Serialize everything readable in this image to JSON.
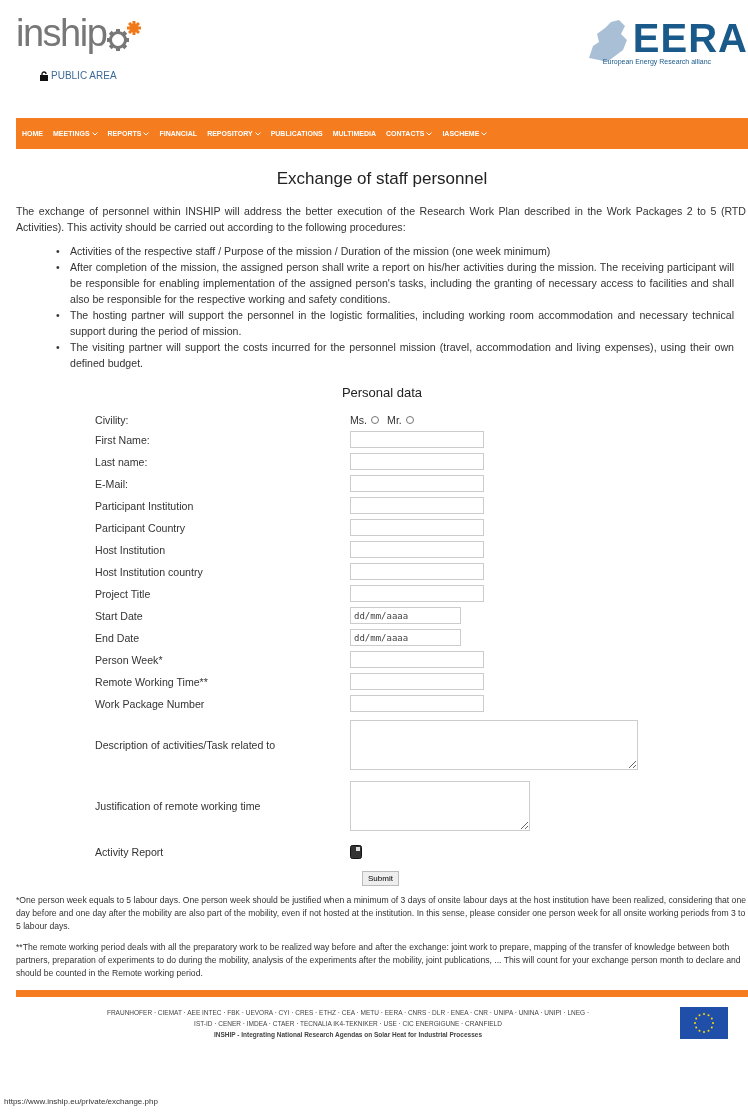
{
  "header": {
    "logo_text": "inship",
    "public_area": "PUBLIC AREA",
    "partner_logo": {
      "text": "EERA",
      "tagline": "European Energy Research allianc"
    }
  },
  "nav": [
    {
      "label": "HOME",
      "dropdown": false
    },
    {
      "label": "MEETINGS",
      "dropdown": true
    },
    {
      "label": "REPORTS",
      "dropdown": true
    },
    {
      "label": "FINANCIAL",
      "dropdown": false
    },
    {
      "label": "REPOSITORY",
      "dropdown": true
    },
    {
      "label": "PUBLICATIONS",
      "dropdown": false
    },
    {
      "label": "MULTIMEDIA",
      "dropdown": false
    },
    {
      "label": "CONTACTS",
      "dropdown": true
    },
    {
      "label": "IASCHEME",
      "dropdown": true
    }
  ],
  "title": "Exchange of staff personnel",
  "intro": "The exchange of personnel within INSHIP will address the better execution of the Research Work Plan described in the Work Packages 2 to 5 (RTD Activities). This activity should be carried out according to the following procedures:",
  "procedures": [
    {
      "marker": "•",
      "text": "Activities of the respective staff / Purpose of the mission / Duration of the mission (one week minimum)"
    },
    {
      "marker": "•",
      "text": "After completion of the mission, the assigned person shall write a report on his/her activities during the mission. The receiving participant will be responsible for enabling implementation of the assigned person's tasks, including the granting of necessary access to facilities and shall also be responsible for the respective working and safety conditions."
    },
    {
      "marker": "•",
      "text": "The hosting partner will support the personnel in the logistic formalities, including working room accommodation and necessary technical support during the period of mission."
    },
    {
      "marker": "•",
      "text": "The visiting partner will support the costs incurred for the personnel mission (travel, accommodation and living expenses), using their own defined budget."
    }
  ],
  "form": {
    "title": "Personal data",
    "fields": [
      {
        "kind": "radio",
        "label": "Civility:",
        "options": [
          {
            "label": "Ms.",
            "selected": false
          },
          {
            "label": "Mr.",
            "selected": false
          }
        ]
      },
      {
        "kind": "text",
        "label": "First Name:"
      },
      {
        "kind": "text",
        "label": "Last name:"
      },
      {
        "kind": "text",
        "label": "E-Mail:"
      },
      {
        "kind": "text",
        "label": "Participant Institution"
      },
      {
        "kind": "text",
        "label": "Participant Country"
      },
      {
        "kind": "text",
        "label": "Host Institution"
      },
      {
        "kind": "text",
        "label": "Host Institution country"
      },
      {
        "kind": "text",
        "label": "Project Title"
      },
      {
        "kind": "date",
        "label": "Start Date",
        "placeholder": "dd/mm/aaaa"
      },
      {
        "kind": "date",
        "label": "End Date",
        "placeholder": "dd/mm/aaaa"
      },
      {
        "kind": "text",
        "label": "Person Week*"
      },
      {
        "kind": "text",
        "label": "Remote Working Time**"
      },
      {
        "kind": "text",
        "label": "Work Package Number"
      },
      {
        "kind": "textarea_wide",
        "label": "Description of activities/Task related to"
      },
      {
        "kind": "textarea",
        "label": "Justification of remote working time"
      },
      {
        "kind": "file",
        "label": "Activity Report"
      }
    ],
    "submit": "Submit"
  },
  "notes": [
    "*One person week equals to 5 labour days. One person week should be justified when a minimum of 3 days of onsite labour days at the host institution have been realized, considering that one day before and one day after the mobility are also part of the mobility, even if not hosted at the institution. In this sense, please consider one person week for all onsite working periods from 3 to 5 labour days.",
    "**The remote working period deals with all the preparatory work to be realized way before and after the exchange: joint work to prepare, mapping of the transfer of knowledge between both partners, preparation of experiments to do during the mobility, analysis of the experiments after the mobility, joint publications, ... This will count for your exchange person month to declare and should be counted in the Remote working period."
  ],
  "footer": {
    "partners": [
      "FRAUNHOFER · CIEMAT · AEE INTEC · FBK · UEVORA · CYI · CRES · ETHZ · CEA · METU · EERA · CNRS · DLR · ENEA · CNR · UNIPA · UNINA · UNIPI · LNEG ·",
      "IST-ID · CENER · IMDEA · CTAER · TECNALIA IK4-TEKNIKER · USE · CIC ENERGIGUNE · CRANFIELD"
    ],
    "tagline": "INSHIP - Integrating National Research Agendas on Solar Heat for Industrial Processes"
  },
  "status_bar": {
    "url": "https://www.inship.eu/private/exchange.php"
  }
}
